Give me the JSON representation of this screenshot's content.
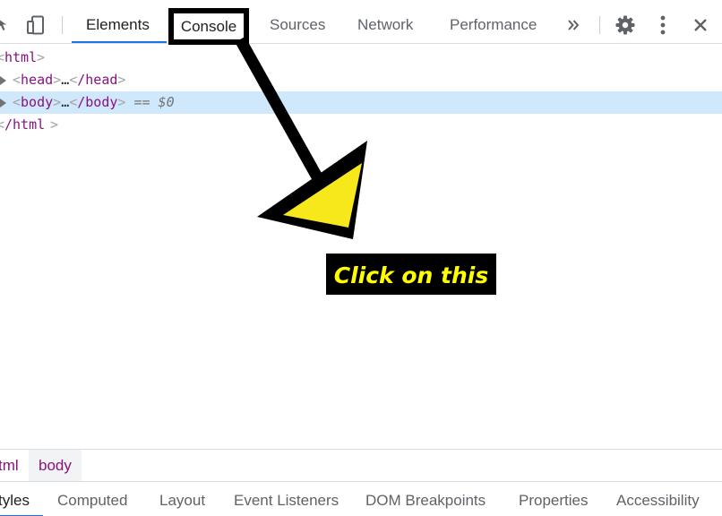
{
  "toolbar": {
    "tabs": [
      {
        "label": "Elements",
        "active": true
      },
      {
        "label": "Console",
        "active": false
      },
      {
        "label": "Sources",
        "active": false
      },
      {
        "label": "Network",
        "active": false
      },
      {
        "label": "Performance",
        "active": false
      }
    ],
    "icons": [
      "inspect-icon",
      "device-toolbar-icon",
      "more-tabs-icon",
      "settings-icon",
      "kebab-menu-icon",
      "close-icon"
    ]
  },
  "dom_tree": {
    "html_open": "html",
    "head_tag": "head",
    "head_ellipsis": "…",
    "head_close": "/head",
    "body_tag": "body",
    "body_ellipsis": "…",
    "body_close": "/body",
    "selected_marker": "== $0",
    "html_close": "/html"
  },
  "annotation": {
    "callout_text": "Click on this",
    "arrow_fill": "#f6e81b",
    "callout_color": "#ffff00"
  },
  "breadcrumbs": [
    {
      "label": "tml"
    },
    {
      "label": "body",
      "active": true
    }
  ],
  "subtabs": [
    {
      "label": "tyles",
      "active": true
    },
    {
      "label": "Computed"
    },
    {
      "label": "Layout"
    },
    {
      "label": "Event Listeners"
    },
    {
      "label": "DOM Breakpoints"
    },
    {
      "label": "Properties"
    },
    {
      "label": "Accessibility"
    }
  ],
  "colors": {
    "accent": "#1a73e8",
    "tag": "#881280",
    "selection": "#cfe8fc"
  }
}
